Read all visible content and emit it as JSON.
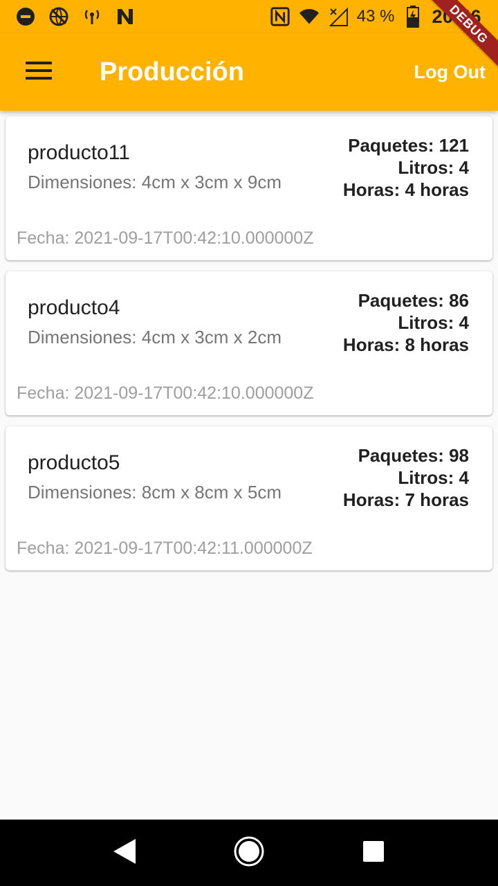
{
  "status_bar": {
    "battery_percent": "43 %",
    "time": "20:46",
    "icons": [
      "do-not-disturb-icon",
      "vpn-globe-icon",
      "hotspot-icon",
      "n-logo-icon",
      "nfc-icon",
      "wifi-icon",
      "no-signal-icon",
      "battery-charging-icon"
    ]
  },
  "app_bar": {
    "title": "Producción",
    "logout_label": "Log Out",
    "debug_label": "DEBUG",
    "color": "#ffb300"
  },
  "products": [
    {
      "name": "producto11",
      "dimensions": "Dimensiones: 4cm x 3cm x 9cm",
      "paquetes": "Paquetes: 121",
      "litros": "Litros: 4",
      "horas": "Horas: 4 horas",
      "fecha": "Fecha: 2021-09-17T00:42:10.000000Z"
    },
    {
      "name": "producto4",
      "dimensions": "Dimensiones: 4cm x 3cm x 2cm",
      "paquetes": "Paquetes: 86",
      "litros": "Litros: 4",
      "horas": "Horas: 8 horas",
      "fecha": "Fecha: 2021-09-17T00:42:10.000000Z"
    },
    {
      "name": "producto5",
      "dimensions": "Dimensiones: 8cm x 8cm x 5cm",
      "paquetes": "Paquetes: 98",
      "litros": "Litros: 4",
      "horas": "Horas: 7 horas",
      "fecha": "Fecha: 2021-09-17T00:42:11.000000Z"
    }
  ],
  "nav_bar": {
    "icons": [
      "back-icon",
      "home-icon",
      "recents-icon"
    ]
  }
}
